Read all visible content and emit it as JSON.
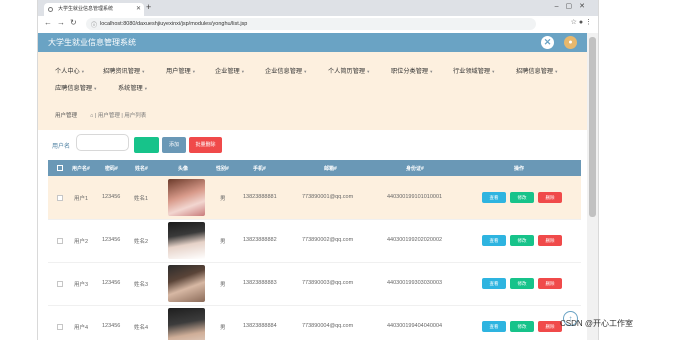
{
  "browser": {
    "tab_title": "大学生就业信息管理系统",
    "url": "localhost:8080/daxueshjiuyexinxi/jsp/modules/yonghu/list.jsp"
  },
  "app": {
    "title": "大学生就业信息管理系统"
  },
  "menu": [
    "个人中心",
    "招聘资讯管理",
    "用户管理",
    "企业管理",
    "企业信息管理",
    "个人简历管理",
    "职位分类管理",
    "行业领域管理",
    "招聘信息管理",
    "应聘信息管理",
    "系统管理"
  ],
  "breadcrumb": {
    "title": "用户管理",
    "path": "| 用户管理 | 用户列表"
  },
  "search": {
    "label": "用户名",
    "placeholder": "",
    "query_button": "",
    "add_button": "添加",
    "batch_delete_button": "批量删除"
  },
  "table": {
    "headers": [
      "用户名#",
      "密码#",
      "姓名#",
      "头像",
      "性别#",
      "手机#",
      "邮箱#",
      "身份证#",
      "操作"
    ],
    "rows": [
      {
        "username": "用户1",
        "password": "123456",
        "name": "姓名1",
        "gender": "男",
        "phone": "13823888881",
        "email": "773890001@qq.com",
        "idcard": "440300199101010001"
      },
      {
        "username": "用户2",
        "password": "123456",
        "name": "姓名2",
        "gender": "男",
        "phone": "13823888882",
        "email": "773890002@qq.com",
        "idcard": "440300199202020002"
      },
      {
        "username": "用户3",
        "password": "123456",
        "name": "姓名3",
        "gender": "男",
        "phone": "13823888883",
        "email": "773890003@qq.com",
        "idcard": "440300199303030003"
      },
      {
        "username": "用户4",
        "password": "123456",
        "name": "姓名4",
        "gender": "男",
        "phone": "13823888884",
        "email": "773890004@qq.com",
        "idcard": "440300199404040004"
      }
    ],
    "actions": {
      "view": "查看",
      "edit": "修改",
      "delete": "删除"
    }
  },
  "watermark": "CSDN @开心工作室",
  "colors": {
    "header": "#6aa3c4",
    "nav_background": "#fdf0df",
    "table_header": "#6a98b6",
    "row_highlight": "#fdf0df",
    "view": "#2eb4e0",
    "edit": "#17c38a",
    "delete": "#f04a4a"
  }
}
